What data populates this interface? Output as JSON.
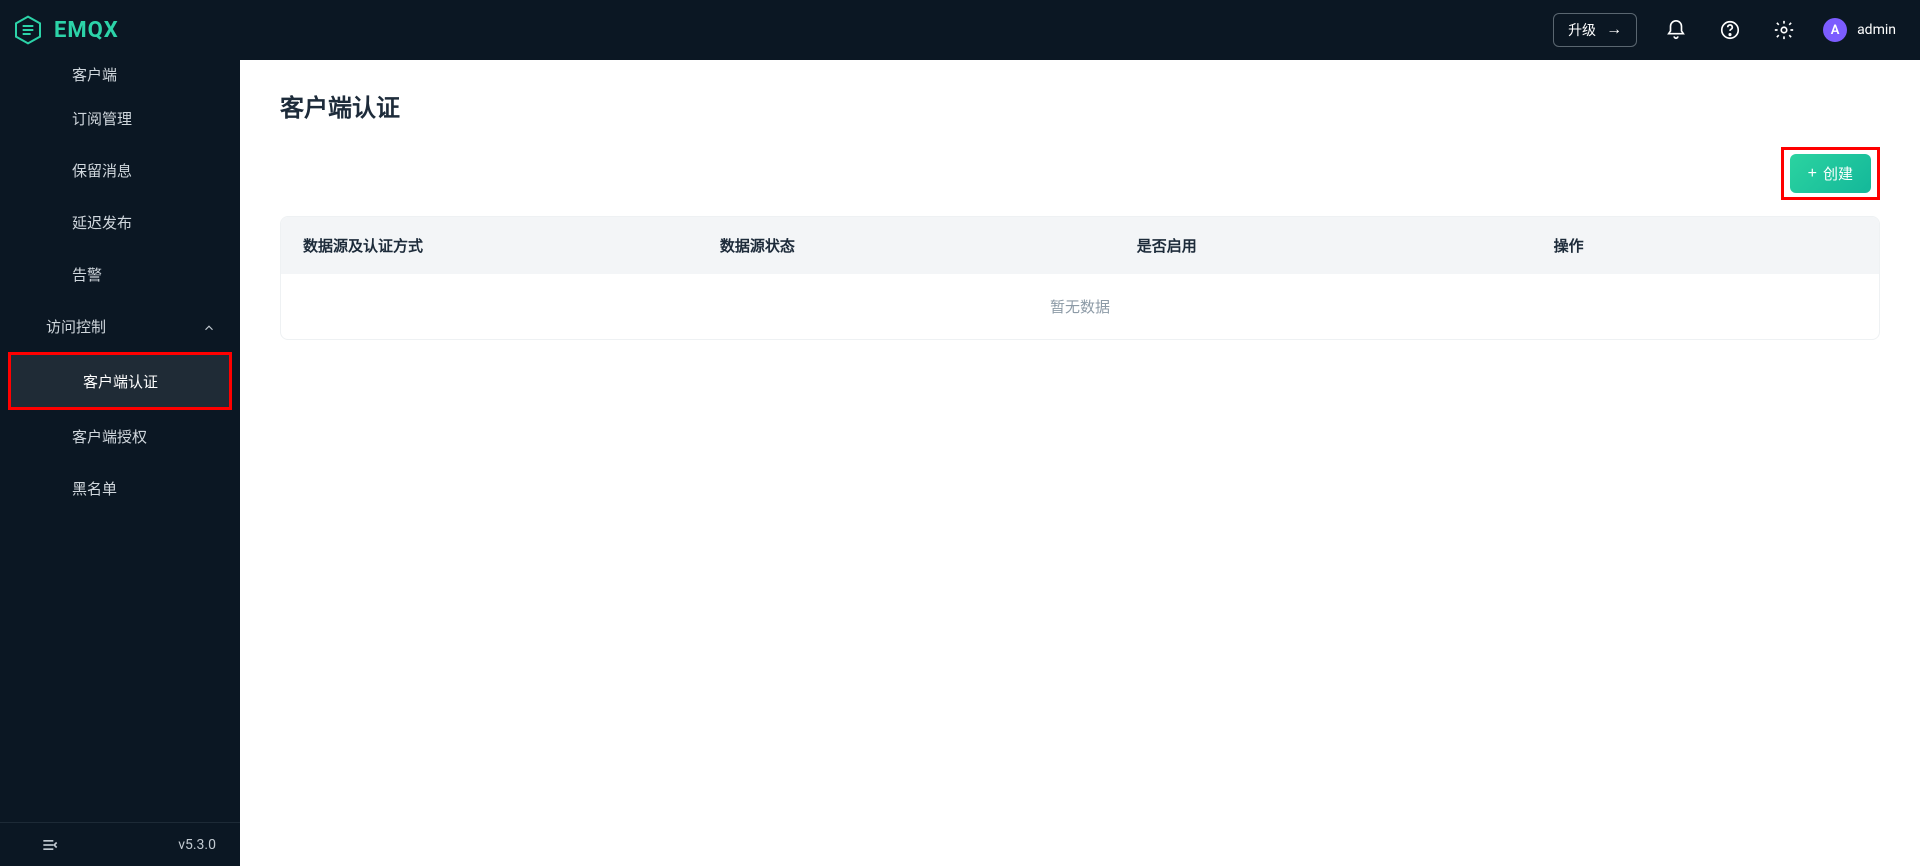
{
  "brand": {
    "name": "EMQX"
  },
  "header": {
    "upgrade_label": "升级",
    "user": {
      "initial": "A",
      "name": "admin"
    }
  },
  "sidebar": {
    "items": [
      {
        "label": "客户端",
        "sub": true,
        "active": false,
        "truncated": true
      },
      {
        "label": "订阅管理",
        "sub": true,
        "active": false
      },
      {
        "label": "保留消息",
        "sub": true,
        "active": false
      },
      {
        "label": "延迟发布",
        "sub": true,
        "active": false
      },
      {
        "label": "告警",
        "sub": true,
        "active": false
      }
    ],
    "group_access": {
      "label": "访问控制",
      "expanded": true
    },
    "access_items": [
      {
        "label": "客户端认证",
        "active": true,
        "highlighted": true
      },
      {
        "label": "客户端授权",
        "active": false
      },
      {
        "label": "黑名单",
        "active": false
      }
    ],
    "footer_version": "v5.3.0"
  },
  "page": {
    "title": "客户端认证",
    "create_label": "创建",
    "columns": [
      "数据源及认证方式",
      "数据源状态",
      "是否启用",
      "操作"
    ],
    "empty_text": "暂无数据"
  }
}
